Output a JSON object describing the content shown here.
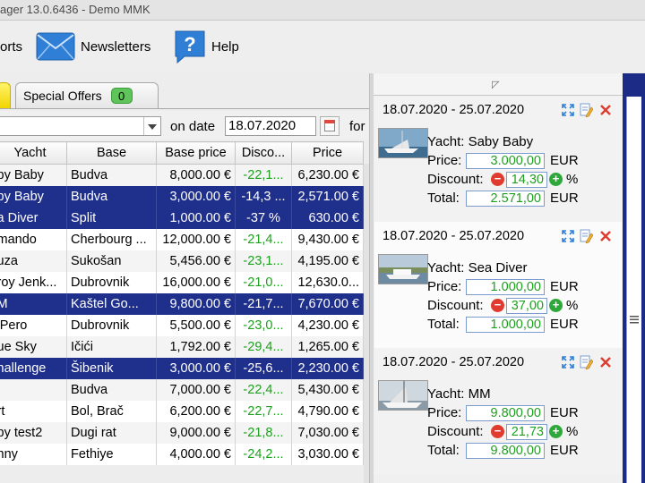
{
  "window": {
    "title": "ager 13.0.6436 - Demo MMK"
  },
  "toolbar": {
    "reports_label": "orts",
    "newsletters_label": "Newsletters",
    "help_label": "Help"
  },
  "tabs": [
    {
      "label": "Special Offers",
      "count": "0"
    }
  ],
  "filter": {
    "on_date_label": "on date",
    "date_value": "18.07.2020",
    "for_label": "for"
  },
  "table": {
    "columns": [
      "Yacht",
      "Base",
      "Base price",
      "Disco...",
      "Price"
    ],
    "rows": [
      {
        "yacht": "by Baby",
        "base": "Budva",
        "base_price": "8,000.00 €",
        "discount": "-22,1...",
        "price": "6,230.00 €",
        "selected": false
      },
      {
        "yacht": "by Baby",
        "base": "Budva",
        "base_price": "3,000.00 €",
        "discount": "-14,3 ...",
        "price": "2,571.00 €",
        "selected": true
      },
      {
        "yacht": "a Diver",
        "base": "Split",
        "base_price": "1,000.00 €",
        "discount": "-37 %",
        "price": "630.00 €",
        "selected": true
      },
      {
        "yacht": "mando",
        "base": "Cherbourg ...",
        "base_price": "12,000.00 €",
        "discount": "-21,4...",
        "price": "9,430.00 €",
        "selected": false
      },
      {
        "yacht": "uza",
        "base": "Sukošan",
        "base_price": "5,456.00 €",
        "discount": "-23,1...",
        "price": "4,195.00 €",
        "selected": false
      },
      {
        "yacht": "roy Jenk...",
        "base": "Dubrovnik",
        "base_price": "16,000.00 €",
        "discount": "-21,0...",
        "price": "12,630.0...",
        "selected": false
      },
      {
        "yacht": "M",
        "base": "Kaštel Go...",
        "base_price": "9,800.00 €",
        "discount": "-21,7...",
        "price": "7,670.00 €",
        "selected": true
      },
      {
        "yacht": "iPero",
        "base": "Dubrovnik",
        "base_price": "5,500.00 €",
        "discount": "-23,0...",
        "price": "4,230.00 €",
        "selected": false
      },
      {
        "yacht": "ue Sky",
        "base": "Ičići",
        "base_price": "1,792.00 €",
        "discount": "-29,4...",
        "price": "1,265.00 €",
        "selected": false
      },
      {
        "yacht": "hallenge",
        "base": "Šibenik",
        "base_price": "3,000.00 €",
        "discount": "-25,6...",
        "price": "2,230.00 €",
        "selected": true
      },
      {
        "yacht": "",
        "base": "Budva",
        "base_price": "7,000.00 €",
        "discount": "-22,4...",
        "price": "5,430.00 €",
        "selected": false
      },
      {
        "yacht": "rt",
        "base": "Bol, Brač",
        "base_price": "6,200.00 €",
        "discount": "-22,7...",
        "price": "4,790.00 €",
        "selected": false
      },
      {
        "yacht": "by test2",
        "base": "Dugi rat",
        "base_price": "9,000.00 €",
        "discount": "-21,8...",
        "price": "7,030.00 €",
        "selected": false
      },
      {
        "yacht": "nny",
        "base": "Fethiye",
        "base_price": "4,000.00 €",
        "discount": "-24,2...",
        "price": "3,030.00 €",
        "selected": false
      }
    ]
  },
  "offers": [
    {
      "dates": "18.07.2020 - 25.07.2020",
      "yacht": "Yacht: Saby Baby",
      "price": "3.000,00",
      "discount": "14,30",
      "total": "2.571,00"
    },
    {
      "dates": "18.07.2020 - 25.07.2020",
      "yacht": "Yacht: Sea Diver",
      "price": "1.000,00",
      "discount": "37,00",
      "total": "1.000,00"
    },
    {
      "dates": "18.07.2020 - 25.07.2020",
      "yacht": "Yacht: MM",
      "price": "9.800,00",
      "discount": "21,73",
      "total": "9.800,00"
    }
  ],
  "labels": {
    "price": "Price:",
    "discount": "Discount:",
    "total": "Total:",
    "currency": "EUR",
    "percent": "%",
    "minus": "−",
    "plus": "+"
  },
  "icons": {
    "card_actions": [
      "expand-icon",
      "edit-icon",
      "close-icon"
    ]
  },
  "colors": {
    "selection": "#1f2f8c",
    "discount_green": "#1e9f1e",
    "rail_blue": "#1b2b86",
    "badge_green": "#5fc45a",
    "close_red": "#e03b2e"
  }
}
